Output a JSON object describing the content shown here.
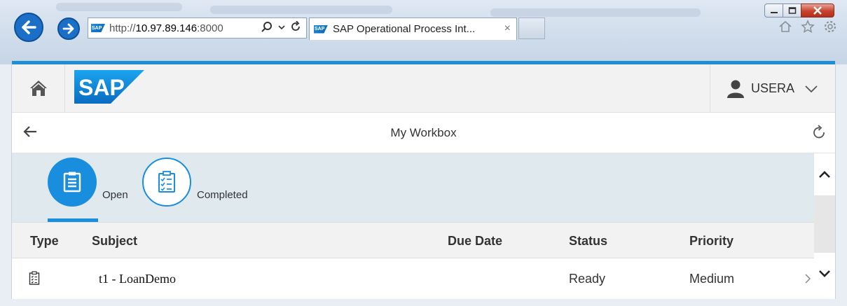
{
  "browser": {
    "url_prefix": "http://",
    "url_host": "10.97.89.146",
    "url_port": ":8000",
    "tab_title": "SAP Operational Process Int...",
    "tab_close": "×",
    "sap_icon_text": "SAP"
  },
  "shell": {
    "logo": "SAP",
    "user": "USERA"
  },
  "page": {
    "title": "My Workbox"
  },
  "icon_tabs": [
    {
      "label": "Open",
      "selected": true
    },
    {
      "label": "Completed",
      "selected": false
    }
  ],
  "table": {
    "columns": [
      "Type",
      "Subject",
      "Due Date",
      "Status",
      "Priority"
    ],
    "rows": [
      {
        "subject": "t1 - LoanDemo",
        "due_date": "",
        "status": "Ready",
        "priority": "Medium"
      }
    ]
  },
  "colors": {
    "accent": "#1a8ede",
    "shell_bg": "#f2f2f2",
    "tabbar_bg": "#dfe9ee"
  }
}
